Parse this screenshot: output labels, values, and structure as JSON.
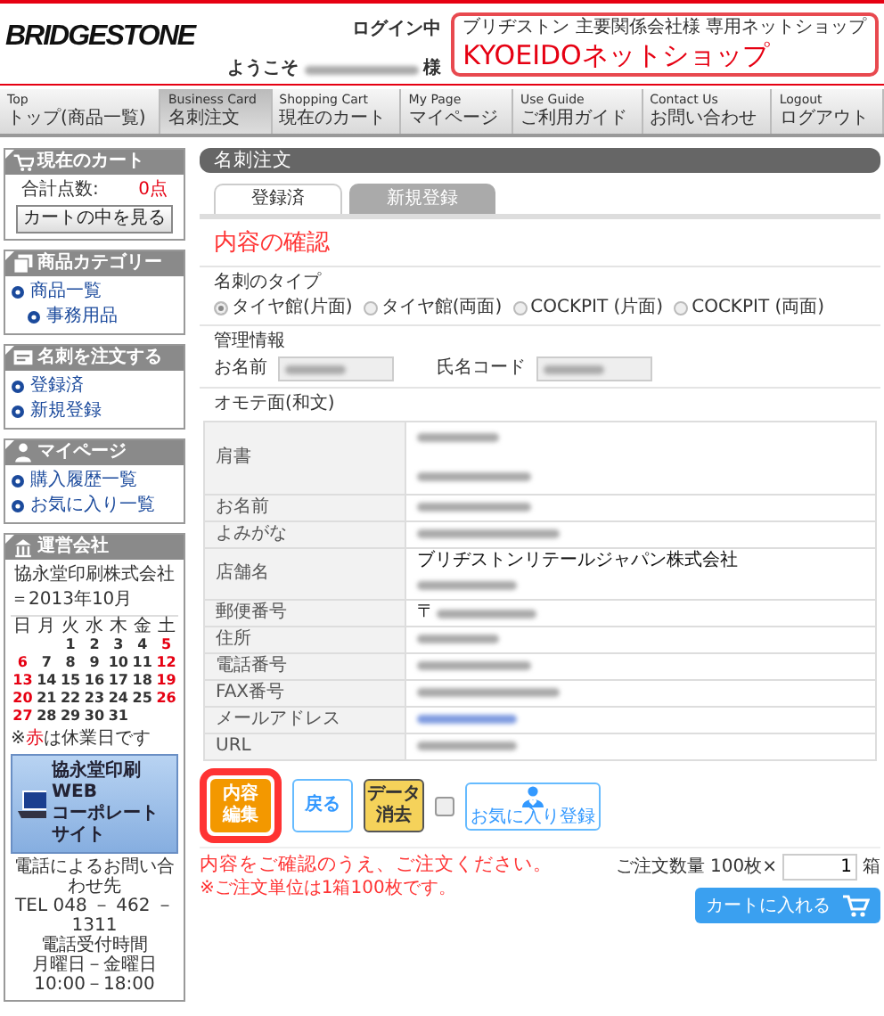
{
  "header": {
    "logo": "BRIDGESTONE",
    "login_status": "ログイン中",
    "welcome": "ようこそ",
    "welcome_suffix": "様",
    "shop_tagline": "ブリヂストン 主要関係会社様 専用ネットショップ",
    "shop_name": "KYOEIDOネットショップ"
  },
  "nav": [
    {
      "en": "Top",
      "ja": "トップ(商品一覧)",
      "selected": false
    },
    {
      "en": "Business Card",
      "ja": "名刺注文",
      "selected": true
    },
    {
      "en": "Shopping Cart",
      "ja": "現在のカート",
      "selected": false
    },
    {
      "en": "My Page",
      "ja": "マイページ",
      "selected": false
    },
    {
      "en": "Use Guide",
      "ja": "ご利用ガイド",
      "selected": false
    },
    {
      "en": "Contact Us",
      "ja": "お問い合わせ",
      "selected": false
    },
    {
      "en": "Logout",
      "ja": "ログアウト",
      "selected": false
    }
  ],
  "sidebar": {
    "cart": {
      "title": "現在のカート",
      "total_label": "合計点数:",
      "total": "0点",
      "button": "カートの中を見る"
    },
    "category": {
      "title": "商品カテゴリー",
      "items": [
        {
          "label": "商品一覧",
          "children": [
            {
              "label": "事務用品"
            }
          ]
        }
      ]
    },
    "card_order": {
      "title": "名刺を注文する",
      "items": [
        {
          "label": "登録済"
        },
        {
          "label": "新規登録"
        }
      ]
    },
    "mypage": {
      "title": "マイページ",
      "items": [
        {
          "label": "購入履歴一覧"
        },
        {
          "label": "お気に入り一覧"
        }
      ]
    },
    "company": {
      "title": "運営会社",
      "name": "協永堂印刷株式会社",
      "month": "＝2013年10月",
      "weekdays": [
        "日",
        "月",
        "火",
        "水",
        "木",
        "金",
        "土"
      ],
      "weeks": [
        [
          {
            "day": "1",
            "holiday": false
          },
          {
            "day": "2",
            "holiday": false
          },
          {
            "day": "3",
            "holiday": false
          },
          {
            "day": "4",
            "holiday": false
          },
          {
            "day": "5",
            "holiday": true
          }
        ],
        [
          {
            "day": "6",
            "holiday": true
          },
          {
            "day": "7",
            "holiday": false
          },
          {
            "day": "8",
            "holiday": false
          },
          {
            "day": "9",
            "holiday": false
          },
          {
            "day": "10",
            "holiday": false
          },
          {
            "day": "11",
            "holiday": false
          },
          {
            "day": "12",
            "holiday": true
          }
        ],
        [
          {
            "day": "13",
            "holiday": true
          },
          {
            "day": "14",
            "holiday": false
          },
          {
            "day": "15",
            "holiday": false
          },
          {
            "day": "16",
            "holiday": false
          },
          {
            "day": "17",
            "holiday": false
          },
          {
            "day": "18",
            "holiday": false
          },
          {
            "day": "19",
            "holiday": true
          }
        ],
        [
          {
            "day": "20",
            "holiday": true
          },
          {
            "day": "21",
            "holiday": false
          },
          {
            "day": "22",
            "holiday": false
          },
          {
            "day": "23",
            "holiday": false
          },
          {
            "day": "24",
            "holiday": false
          },
          {
            "day": "25",
            "holiday": false
          },
          {
            "day": "26",
            "holiday": true
          }
        ],
        [
          {
            "day": "27",
            "holiday": true
          },
          {
            "day": "28",
            "holiday": false
          },
          {
            "day": "29",
            "holiday": false
          },
          {
            "day": "30",
            "holiday": false
          },
          {
            "day": "31",
            "holiday": false
          }
        ]
      ],
      "note_mark": "※",
      "note_highlight": "赤",
      "note_text": "は休業日です",
      "banner": [
        "協永堂印刷 WEB",
        "コーポレートサイト"
      ],
      "contact": [
        "電話によるお問い合わせ先",
        "TEL 048 － 462 － 1311",
        "電話受付時間",
        "月曜日－金曜日10:00－18:00"
      ]
    }
  },
  "main": {
    "title": "名刺注文",
    "tabs": [
      {
        "label": "登録済",
        "selected": true
      },
      {
        "label": "新規登録",
        "selected": false
      }
    ],
    "heading": "内容の確認",
    "card_type": {
      "label": "名刺のタイプ",
      "options": [
        {
          "label": "タイヤ館(片面)",
          "selected": true
        },
        {
          "label": "タイヤ館(両面)",
          "selected": false
        },
        {
          "label": "COCKPIT (片面)",
          "selected": false
        },
        {
          "label": "COCKPIT (両面)",
          "selected": false
        }
      ]
    },
    "management": {
      "label": "管理情報",
      "fields": [
        {
          "label": "お名前",
          "redacted": true
        },
        {
          "label": "氏名コード",
          "redacted": true
        }
      ]
    },
    "front_label": "オモテ面(和文)",
    "rows": [
      {
        "label": "肩書",
        "values": [
          {
            "kind": "blurred"
          },
          {
            "kind": "blurred"
          }
        ]
      },
      {
        "label": "お名前",
        "values": [
          {
            "kind": "blurred"
          }
        ]
      },
      {
        "label": "よみがな",
        "values": [
          {
            "kind": "blurred"
          }
        ]
      },
      {
        "label": "店舗名",
        "values": [
          {
            "kind": "text",
            "text": "ブリヂストンリテールジャパン株式会社"
          },
          {
            "kind": "blurred"
          }
        ]
      },
      {
        "label": "郵便番号",
        "values": [
          {
            "kind": "blurred",
            "prefix": "〒"
          }
        ]
      },
      {
        "label": "住所",
        "values": [
          {
            "kind": "blurred"
          }
        ]
      },
      {
        "label": "電話番号",
        "values": [
          {
            "kind": "blurred"
          }
        ]
      },
      {
        "label": "FAX番号",
        "values": [
          {
            "kind": "blurred"
          }
        ]
      },
      {
        "label": "メールアドレス",
        "values": [
          {
            "kind": "blurred_link"
          }
        ]
      },
      {
        "label": "URL",
        "values": [
          {
            "kind": "blurred"
          }
        ]
      }
    ],
    "actions": [
      {
        "kind": "edit",
        "label": "内容編集",
        "highlighted": true
      },
      {
        "kind": "back",
        "label": "戻る",
        "highlighted": false
      },
      {
        "kind": "clear",
        "label": "データ消去",
        "highlighted": false
      }
    ],
    "favorite": {
      "checked": false,
      "label": "お気に入り登録"
    },
    "message": "内容をご確認のうえ、ご注文ください。",
    "note": "※ご注文単位は1箱100枚です。",
    "quantity": {
      "label": "ご注文数量",
      "unit_price": "100枚×",
      "value": "1",
      "unit": "箱"
    },
    "cart_button": "カートに入れる"
  }
}
